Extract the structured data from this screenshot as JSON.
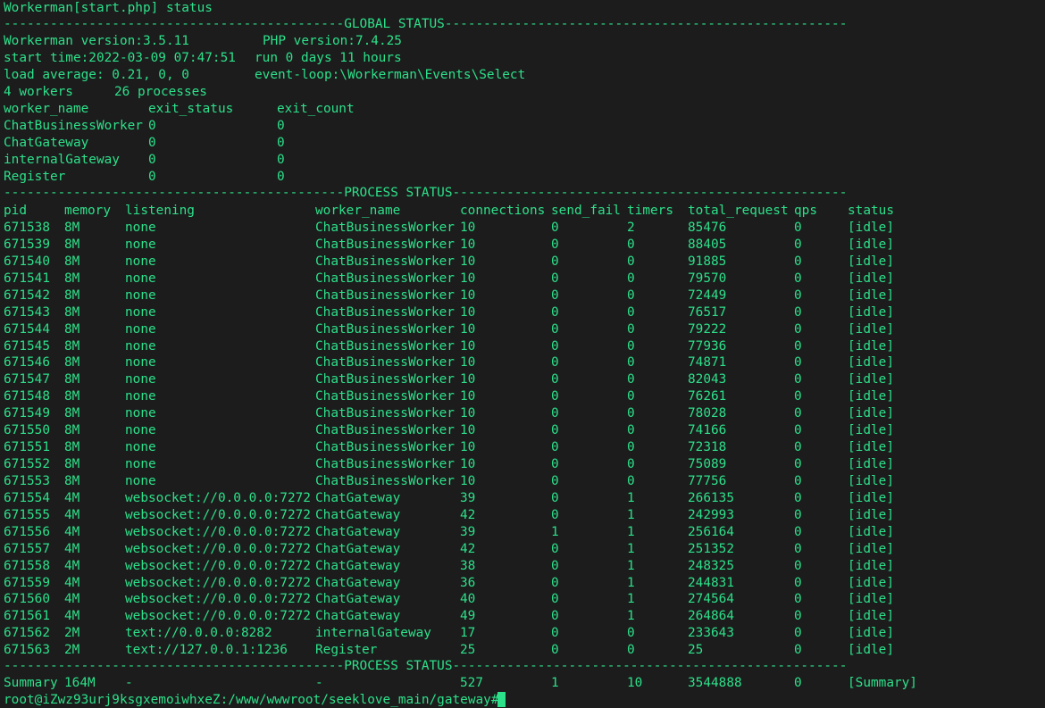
{
  "terminal": {
    "title_line": "Workerman[start.php] status",
    "global_status_line": "--------------------------------------------GLOBAL STATUS----------------------------------------------------",
    "workerman_version": "Workerman version:3.5.11",
    "php_version": "PHP version:7.4.25",
    "start_time": "start time:2022-03-09 07:47:51",
    "run_time": "run 0 days 11 hours",
    "load_average": "load average: 0.21, 0, 0",
    "event_loop": "event-loop:\\Workerman\\Events\\Select",
    "workers": "4 workers",
    "processes": "26 processes",
    "worker_headers": [
      "worker_name",
      "exit_status",
      "exit_count"
    ],
    "worker_rows": [
      [
        "ChatBusinessWorker",
        "0",
        "0"
      ],
      [
        "ChatGateway",
        "0",
        "0"
      ],
      [
        "internalGateway",
        "0",
        "0"
      ],
      [
        "Register",
        "0",
        "0"
      ]
    ],
    "process_status_line": "--------------------------------------------PROCESS STATUS---------------------------------------------------",
    "process_headers": [
      "pid",
      "memory",
      "listening",
      "worker_name",
      "connections",
      "send_fail",
      "timers",
      "total_request",
      "qps",
      "status"
    ],
    "process_rows": [
      [
        "671538",
        "8M",
        "none",
        "ChatBusinessWorker",
        "10",
        "0",
        "2",
        "85476",
        "0",
        "[idle]"
      ],
      [
        "671539",
        "8M",
        "none",
        "ChatBusinessWorker",
        "10",
        "0",
        "0",
        "88405",
        "0",
        "[idle]"
      ],
      [
        "671540",
        "8M",
        "none",
        "ChatBusinessWorker",
        "10",
        "0",
        "0",
        "91885",
        "0",
        "[idle]"
      ],
      [
        "671541",
        "8M",
        "none",
        "ChatBusinessWorker",
        "10",
        "0",
        "0",
        "79570",
        "0",
        "[idle]"
      ],
      [
        "671542",
        "8M",
        "none",
        "ChatBusinessWorker",
        "10",
        "0",
        "0",
        "72449",
        "0",
        "[idle]"
      ],
      [
        "671543",
        "8M",
        "none",
        "ChatBusinessWorker",
        "10",
        "0",
        "0",
        "76517",
        "0",
        "[idle]"
      ],
      [
        "671544",
        "8M",
        "none",
        "ChatBusinessWorker",
        "10",
        "0",
        "0",
        "79222",
        "0",
        "[idle]"
      ],
      [
        "671545",
        "8M",
        "none",
        "ChatBusinessWorker",
        "10",
        "0",
        "0",
        "77936",
        "0",
        "[idle]"
      ],
      [
        "671546",
        "8M",
        "none",
        "ChatBusinessWorker",
        "10",
        "0",
        "0",
        "74871",
        "0",
        "[idle]"
      ],
      [
        "671547",
        "8M",
        "none",
        "ChatBusinessWorker",
        "10",
        "0",
        "0",
        "82043",
        "0",
        "[idle]"
      ],
      [
        "671548",
        "8M",
        "none",
        "ChatBusinessWorker",
        "10",
        "0",
        "0",
        "76261",
        "0",
        "[idle]"
      ],
      [
        "671549",
        "8M",
        "none",
        "ChatBusinessWorker",
        "10",
        "0",
        "0",
        "78028",
        "0",
        "[idle]"
      ],
      [
        "671550",
        "8M",
        "none",
        "ChatBusinessWorker",
        "10",
        "0",
        "0",
        "74166",
        "0",
        "[idle]"
      ],
      [
        "671551",
        "8M",
        "none",
        "ChatBusinessWorker",
        "10",
        "0",
        "0",
        "72318",
        "0",
        "[idle]"
      ],
      [
        "671552",
        "8M",
        "none",
        "ChatBusinessWorker",
        "10",
        "0",
        "0",
        "75089",
        "0",
        "[idle]"
      ],
      [
        "671553",
        "8M",
        "none",
        "ChatBusinessWorker",
        "10",
        "0",
        "0",
        "77756",
        "0",
        "[idle]"
      ],
      [
        "671554",
        "4M",
        "websocket://0.0.0.0:7272",
        "ChatGateway",
        "39",
        "0",
        "1",
        "266135",
        "0",
        "[idle]"
      ],
      [
        "671555",
        "4M",
        "websocket://0.0.0.0:7272",
        "ChatGateway",
        "42",
        "0",
        "1",
        "242993",
        "0",
        "[idle]"
      ],
      [
        "671556",
        "4M",
        "websocket://0.0.0.0:7272",
        "ChatGateway",
        "39",
        "1",
        "1",
        "256164",
        "0",
        "[idle]"
      ],
      [
        "671557",
        "4M",
        "websocket://0.0.0.0:7272",
        "ChatGateway",
        "42",
        "0",
        "1",
        "251352",
        "0",
        "[idle]"
      ],
      [
        "671558",
        "4M",
        "websocket://0.0.0.0:7272",
        "ChatGateway",
        "38",
        "0",
        "1",
        "248325",
        "0",
        "[idle]"
      ],
      [
        "671559",
        "4M",
        "websocket://0.0.0.0:7272",
        "ChatGateway",
        "36",
        "0",
        "1",
        "244831",
        "0",
        "[idle]"
      ],
      [
        "671560",
        "4M",
        "websocket://0.0.0.0:7272",
        "ChatGateway",
        "40",
        "0",
        "1",
        "274564",
        "0",
        "[idle]"
      ],
      [
        "671561",
        "4M",
        "websocket://0.0.0.0:7272",
        "ChatGateway",
        "49",
        "0",
        "1",
        "264864",
        "0",
        "[idle]"
      ],
      [
        "671562",
        "2M",
        "text://0.0.0.0:8282",
        "internalGateway",
        "17",
        "0",
        "0",
        "233643",
        "0",
        "[idle]"
      ],
      [
        "671563",
        "2M",
        "text://127.0.0.1:1236",
        "Register",
        "25",
        "0",
        "0",
        "25",
        "0",
        "[idle]"
      ]
    ],
    "process_status_line_2": "--------------------------------------------PROCESS STATUS---------------------------------------------------",
    "summary_row": [
      "Summary",
      "164M",
      "-",
      "-",
      "527",
      "1",
      "10",
      "3544888",
      "0",
      "[Summary]"
    ],
    "prompt": "root@iZwz93urj9ksgxemoiwhxeZ:/www/wwwroot/seeklove_main/gateway#"
  },
  "colors": {
    "background": "#1c1c1c",
    "text": "#2de08a"
  }
}
